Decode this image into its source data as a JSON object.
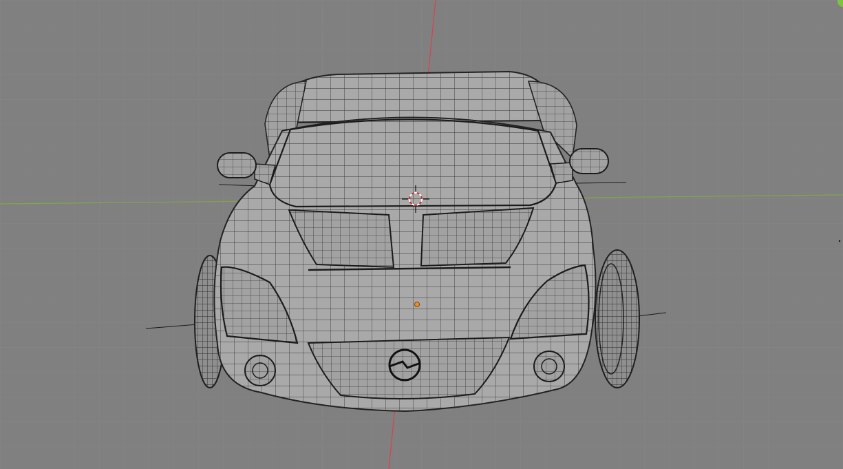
{
  "viewport": {
    "view": "front",
    "shading": "solid-wireframe",
    "colors": {
      "background": "#808080",
      "grid": "#8a8a8a",
      "axis_x": "#7fa64a",
      "axis_z": "#d9414a",
      "mesh_fill": "#a9a9a9",
      "wire": "#2d2d2d",
      "origin": "#f28c1e",
      "cursor_ring_a": "#ffffff",
      "cursor_ring_b": "#d12b2b"
    }
  },
  "gizmo": {
    "icon": "navigation-gizmo-corner"
  },
  "scene": {
    "object": "car-body-mesh",
    "badge_icon": "opel-lightning-logo"
  },
  "cursor": {
    "icon": "3d-cursor-icon"
  },
  "origin": {
    "icon": "object-origin-dot"
  }
}
